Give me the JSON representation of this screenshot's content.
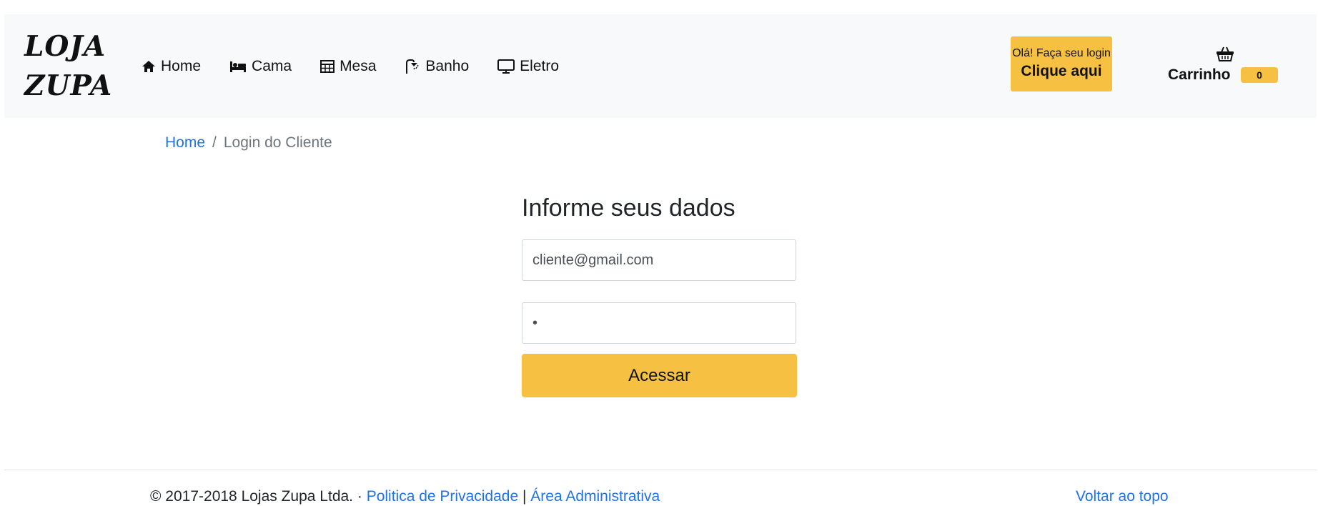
{
  "brand": {
    "line1": "LOJA",
    "line2": "ZUPA"
  },
  "nav": {
    "items": [
      {
        "label": "Home",
        "icon": "home-icon"
      },
      {
        "label": "Cama",
        "icon": "bed-icon"
      },
      {
        "label": "Mesa",
        "icon": "table-icon"
      },
      {
        "label": "Banho",
        "icon": "shower-icon"
      },
      {
        "label": "Eletro",
        "icon": "monitor-icon"
      }
    ]
  },
  "account": {
    "greeting": "Olá! Faça seu login",
    "cta": "Clique aqui"
  },
  "cart": {
    "label": "Carrinho",
    "count": "0",
    "icon": "basket-icon"
  },
  "breadcrumb": {
    "home": "Home",
    "separator": "/",
    "current": "Login do Cliente"
  },
  "form": {
    "title": "Informe seus dados",
    "email_value": "cliente@gmail.com",
    "password_value": "•",
    "submit_label": "Acessar"
  },
  "footer": {
    "copyright": "© 2017-2018 Lojas Zupa Ltda. ·",
    "privacy": "Politica de Privacidade",
    "separator": "|",
    "admin": "Área Administrativa",
    "back_to_top": "Voltar ao topo"
  },
  "colors": {
    "accent": "#f6c142",
    "link": "#1e73e8",
    "navbar_bg": "#f8f9fa"
  }
}
